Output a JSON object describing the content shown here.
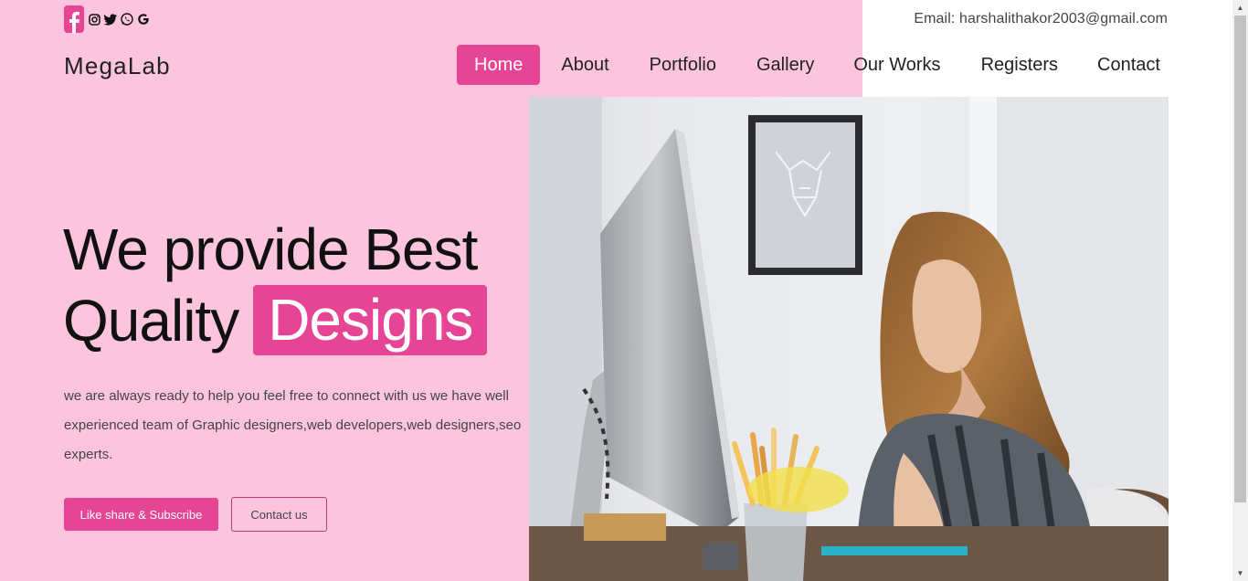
{
  "topbar": {
    "email": "Email: harshalithakor2003@gmail.com",
    "social_icons": [
      "facebook-icon",
      "instagram-icon",
      "twitter-icon",
      "whatsapp-icon",
      "google-icon"
    ]
  },
  "header": {
    "brand": "MegaLab",
    "nav": [
      {
        "label": "Home",
        "active": true
      },
      {
        "label": "About"
      },
      {
        "label": "Portfolio"
      },
      {
        "label": "Gallery"
      },
      {
        "label": "Our Works"
      },
      {
        "label": "Registers"
      },
      {
        "label": "Contact"
      }
    ]
  },
  "hero": {
    "line1": "We provide Best",
    "line2": "Quality",
    "highlight": "Designs",
    "description": "we are always ready to help you feel free to connect with us we have well experienced team of Graphic designers,web developers,web designers,seo experts.",
    "primary_button": "Like share & Subscribe",
    "secondary_button": "Contact us"
  },
  "colors": {
    "accent": "#e54594",
    "background": "#fcc5dd"
  }
}
